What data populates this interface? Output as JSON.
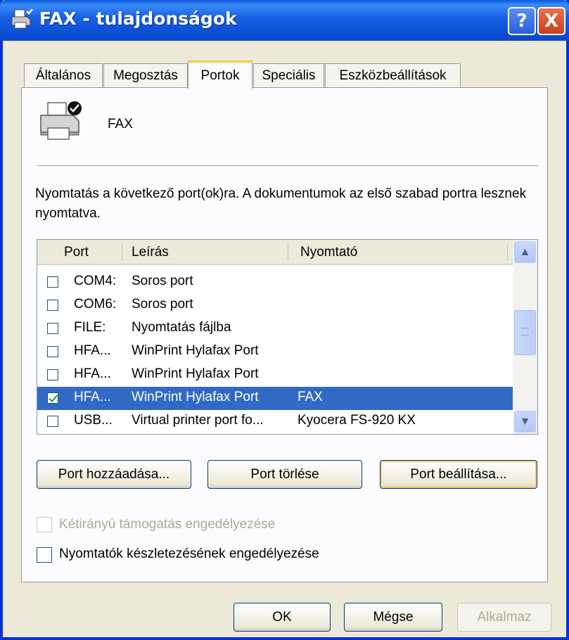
{
  "window": {
    "title": "FAX - tulajdonságok"
  },
  "titlebar": {
    "help_label": "?",
    "close_label": "X"
  },
  "tabs": [
    {
      "label": "Általános"
    },
    {
      "label": "Megosztás"
    },
    {
      "label": "Portok",
      "active": true
    },
    {
      "label": "Speciális"
    },
    {
      "label": "Eszközbeállítások"
    }
  ],
  "printer": {
    "name": "FAX"
  },
  "description": "Nyomtatás a következő port(ok)ra. A dokumentumok az első szabad portra lesznek nyomtatva.",
  "port_list": {
    "columns": [
      "Port",
      "Leírás",
      "Nyomtató"
    ],
    "rows": [
      {
        "port": "COM4:",
        "description": "Soros port",
        "printer": "",
        "checked": false
      },
      {
        "port": "COM6:",
        "description": "Soros port",
        "printer": "",
        "checked": false
      },
      {
        "port": "FILE:",
        "description": "Nyomtatás fájlba",
        "printer": "",
        "checked": false
      },
      {
        "port": "HFA...",
        "description": "WinPrint Hylafax Port",
        "printer": "",
        "checked": false
      },
      {
        "port": "HFA...",
        "description": "WinPrint Hylafax Port",
        "printer": "",
        "checked": false
      },
      {
        "port": "HFA...",
        "description": "WinPrint Hylafax Port",
        "printer": "FAX",
        "checked": true,
        "selected": true
      },
      {
        "port": "USB...",
        "description": "Virtual printer port fo...",
        "printer": "Kyocera FS-920 KX",
        "checked": false
      }
    ]
  },
  "port_buttons": {
    "add": "Port hozzáadása...",
    "delete": "Port törlése",
    "configure": "Port beállítása..."
  },
  "options": {
    "bidirectional": {
      "label": "Kétirányú támogatás engedélyezése",
      "checked": false,
      "enabled": false
    },
    "pooling": {
      "label": "Nyomtatók készletezésének engedélyezése",
      "checked": false,
      "enabled": true
    }
  },
  "dialog_buttons": {
    "ok": "OK",
    "cancel": "Mégse",
    "apply": "Alkalmaz"
  },
  "colors": {
    "title_blue": "#0a5ae0",
    "selection": "#316ac5",
    "dialog_bg": "#ece9d8",
    "tab_accent": "#ffc83c"
  }
}
